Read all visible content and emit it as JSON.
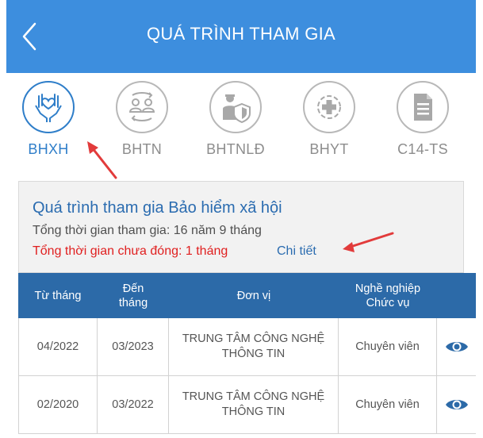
{
  "header": {
    "title": "QUÁ TRÌNH THAM GIA",
    "back_icon": "chevron-left-icon"
  },
  "categories": [
    {
      "label": "BHXH",
      "icon": "heart-hands-icon",
      "active": true
    },
    {
      "label": "BHTN",
      "icon": "people-exchange-icon",
      "active": false
    },
    {
      "label": "BHTNLĐ",
      "icon": "worker-shield-icon",
      "active": false
    },
    {
      "label": "BHYT",
      "icon": "medical-cross-icon",
      "active": false
    },
    {
      "label": "C14-TS",
      "icon": "document-icon",
      "active": false
    }
  ],
  "info": {
    "title": "Quá trình tham gia Bảo hiểm xã hội",
    "total_time": "Tổng thời gian tham gia: 16 năm 9 tháng",
    "unpaid_time": "Tổng thời gian chưa đóng: 1 tháng",
    "detail_link": "Chi tiết"
  },
  "table": {
    "headers": [
      "Từ tháng",
      "Đến\ntháng",
      "Đơn vị",
      "Nghề nghiệp\nChức vụ",
      ""
    ],
    "rows": [
      {
        "from": "04/2022",
        "to": "03/2023",
        "unit": "TRUNG TÂM CÔNG NGHỆ\nTHÔNG TIN",
        "job": "Chuyên viên",
        "action_icon": "eye-icon"
      },
      {
        "from": "02/2020",
        "to": "03/2022",
        "unit": "TRUNG TÂM CÔNG NGHỆ\nTHÔNG TIN",
        "job": "Chuyên viên",
        "action_icon": "eye-icon"
      }
    ]
  },
  "colors": {
    "header_bg": "#3d8ede",
    "accent": "#2f7ec9",
    "table_header_bg": "#2c6aa8",
    "warning_text": "#e02020",
    "annotation_arrow": "#e23b3b"
  }
}
